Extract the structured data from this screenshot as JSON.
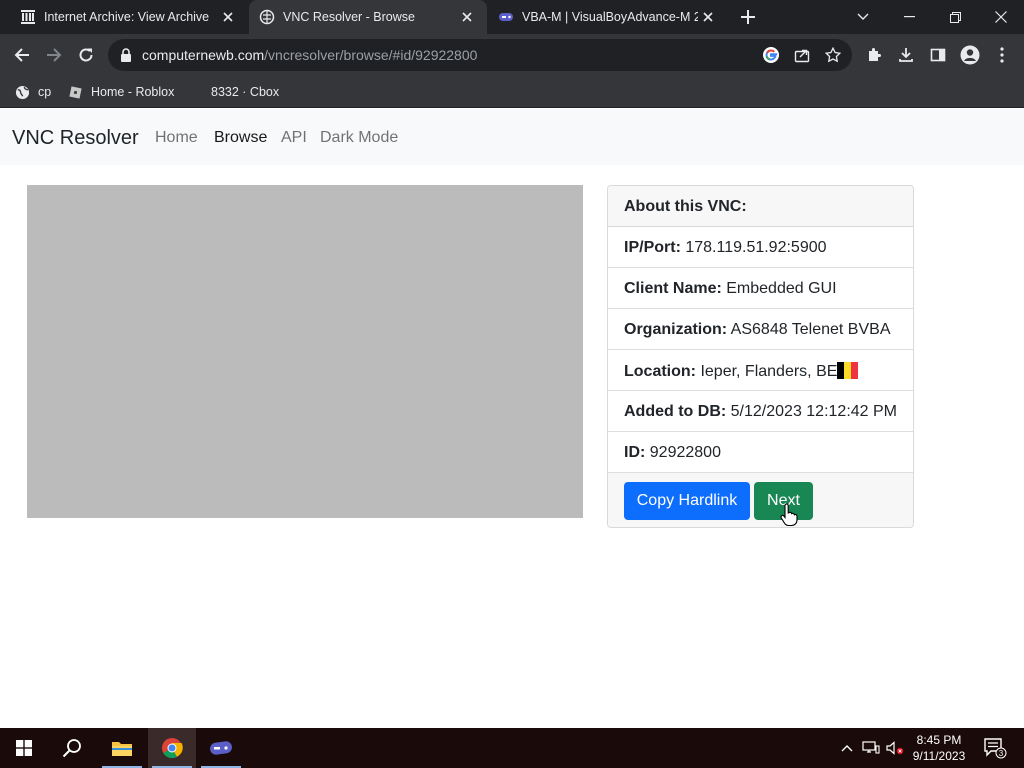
{
  "browser": {
    "tabs": [
      {
        "title": "Internet Archive: View Archive",
        "icon": "internet-archive-icon",
        "active": false
      },
      {
        "title": "VNC Resolver - Browse",
        "icon": "vnc-resolver-icon",
        "active": true
      },
      {
        "title": "VBA-M | VisualBoyAdvance-M 2.",
        "icon": "vba-gamepad-icon",
        "active": false
      }
    ],
    "url": {
      "host": "computernewb.com",
      "path": "/vncresolver/browse/#id/92922800"
    },
    "bookmarks": [
      {
        "label": "cp",
        "icon": "globe-icon"
      },
      {
        "label": "Home - Roblox",
        "icon": "roblox-icon"
      },
      {
        "label": "8332 · Cbox",
        "icon": ""
      }
    ],
    "colors": {
      "tabstrip": "#202124",
      "toolbar": "#35363a"
    }
  },
  "site": {
    "brand": "VNC Resolver",
    "nav": [
      {
        "label": "Home",
        "active": false
      },
      {
        "label": "Browse",
        "active": true
      },
      {
        "label": "API",
        "active": false
      },
      {
        "label": "Dark Mode",
        "active": false
      }
    ]
  },
  "vnc_card": {
    "header": "About this VNC:",
    "rows": [
      {
        "label": "IP/Port:",
        "value": "178.119.51.92:5900"
      },
      {
        "label": "Client Name:",
        "value": "Embedded GUI"
      },
      {
        "label": "Organization:",
        "value": "AS6848 Telenet BVBA"
      },
      {
        "label": "Location:",
        "value": "Ieper, Flanders, BE"
      },
      {
        "label": "Added to DB:",
        "value": "5/12/2023 12:12:42 PM"
      },
      {
        "label": "ID:",
        "value": "92922800"
      }
    ],
    "flag_colors": [
      "#000000",
      "#fdda24",
      "#ef3340"
    ],
    "buttons": {
      "copy": "Copy Hardlink",
      "next": "Next"
    },
    "colors": {
      "primary": "#0d6efd",
      "success": "#198754"
    }
  },
  "taskbar": {
    "apps": [
      "windows-start-icon",
      "search-icon",
      "file-explorer-icon",
      "chrome-icon",
      "vba-gamepad-icon"
    ],
    "time": "8:45 PM",
    "date": "9/11/2023",
    "notifications": "3"
  }
}
